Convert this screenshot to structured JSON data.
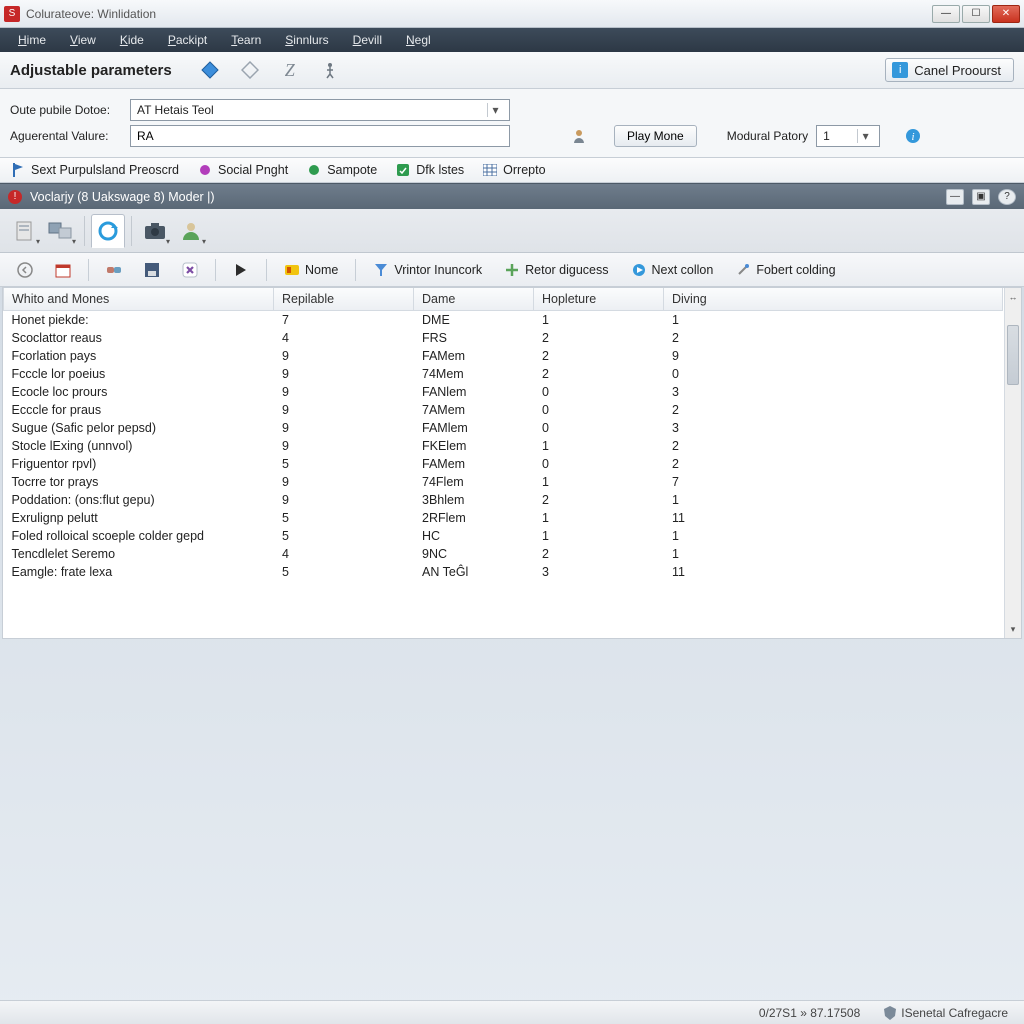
{
  "window": {
    "title": "Colurateove: Winlidation"
  },
  "menu": {
    "items": [
      "Hime",
      "View",
      "Kide",
      "Packipt",
      "Tearn",
      "Sinnlurs",
      "Devill",
      "Negl"
    ]
  },
  "ribbon": {
    "heading": "Adjustable parameters",
    "action_label": "Canel Proourst"
  },
  "form": {
    "dotoe_label": "Oute pubile Dotoe:",
    "dotoe_value": "AT Hetais Teol",
    "valure_label": "Aguerental Valure:",
    "valure_value": "RA",
    "play_label": "Play Mone",
    "patory_label": "Modural Patory",
    "patory_value": "1"
  },
  "links": {
    "items": [
      {
        "label": "Sext Purpulsland Preoscrd",
        "color": "#2f6db5",
        "icon": "flag"
      },
      {
        "label": "Social Pnght",
        "color": "#b23dbb",
        "icon": "dot"
      },
      {
        "label": "Sampote",
        "color": "#2e9b4f",
        "icon": "dot"
      },
      {
        "label": "Dfk lstes",
        "color": "#2e9b4f",
        "icon": "sq"
      },
      {
        "label": "Orrepto",
        "color": "#4a6fa0",
        "icon": "grid"
      }
    ]
  },
  "section": {
    "title": "Voclarjy (8 Uakswage 8) Moder |)"
  },
  "stdtoolbar": {
    "nome": "Nome",
    "vrintor": "Vrintor Inuncork",
    "retor": "Retor digucess",
    "next": "Next collon",
    "fobert": "Fobert colding"
  },
  "table": {
    "columns": [
      "Whito and Mones",
      "Repilable",
      "Dame",
      "Hopleture",
      "Diving"
    ],
    "rows": [
      {
        "c0": "Honet piekde:",
        "c1": "7",
        "c2": "DME",
        "c3": "1",
        "c4": "1"
      },
      {
        "c0": "Scoclattor reaus",
        "c1": "4",
        "c2": "FRS",
        "c3": "2",
        "c4": "2"
      },
      {
        "c0": "Fcorlation pays",
        "c1": "9",
        "c2": "FAMem",
        "c3": "2",
        "c4": "9"
      },
      {
        "c0": "Fcccle lor poeius",
        "c1": "9",
        "c2": "74Mem",
        "c3": "2",
        "c4": "0"
      },
      {
        "c0": "Ecocle loc prours",
        "c1": "9",
        "c2": "FANlem",
        "c3": "0",
        "c4": "3"
      },
      {
        "c0": "Ecccle for praus",
        "c1": "9",
        "c2": "7AMem",
        "c3": "0",
        "c4": "2"
      },
      {
        "c0": "Sugue (Safic pelor pepsd)",
        "c1": "9",
        "c2": "FAMlem",
        "c3": "0",
        "c4": "3"
      },
      {
        "c0": "Stocle lExing (unnvol)",
        "c1": "9",
        "c2": "FKElem",
        "c3": "1",
        "c4": "2"
      },
      {
        "c0": "Friguentor rpvl)",
        "c1": "5",
        "c2": "FAMem",
        "c3": "0",
        "c4": "2"
      },
      {
        "c0": "Tocrre tor prays",
        "c1": "9",
        "c2": "74Flem",
        "c3": "1",
        "c4": "7"
      },
      {
        "c0": "Poddation: (ons:flut gepu)",
        "c1": "9",
        "c2": "3Bhlem",
        "c3": "2",
        "c4": "1"
      },
      {
        "c0": "Exrulignp pelutt",
        "c1": "5",
        "c2": "2RFlem",
        "c3": "1",
        "c4": "11"
      },
      {
        "c0": "Foled rolloical scoeple colder gepd",
        "c1": "5",
        "c2": "HC",
        "c3": "1",
        "c4": "1"
      },
      {
        "c0": "Tencdlelet Seremo",
        "c1": "4",
        "c2": "9NC",
        "c3": "2",
        "c4": "1"
      },
      {
        "c0": "Eamgle: frate lexa",
        "c1": "5",
        "c2": "AN TeĜl",
        "c3": "3",
        "c4": "11"
      }
    ]
  },
  "status": {
    "position": "0/27S1 » 87.17508",
    "brand": "ISenetal Cafregacre"
  }
}
